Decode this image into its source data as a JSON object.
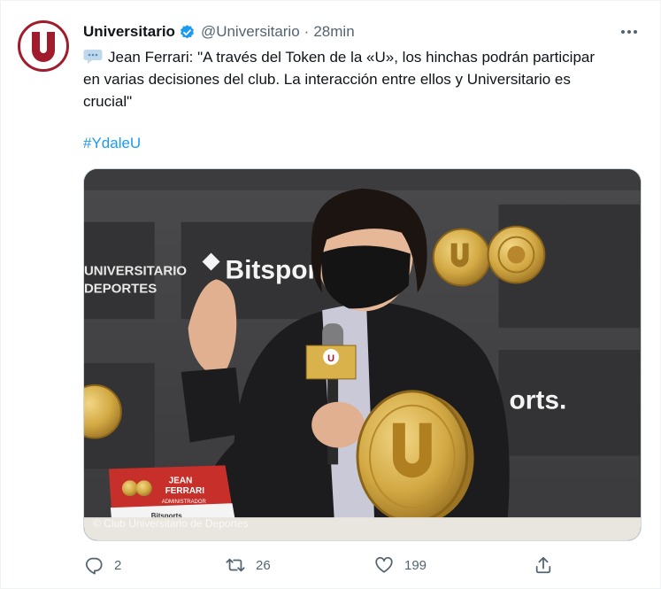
{
  "tweet": {
    "author_name": "Universitario",
    "author_handle": "@Universitario",
    "separator": "·",
    "time": "28min",
    "text": "Jean Ferrari: \"A través del Token de la «U», los hinchas podrán participar en varias decisiones del club. La interacción entre ellos y Universitario es crucial\"",
    "hashtag": "#YdaleU",
    "media": {
      "caption": "© Club Universitario de Deportes",
      "backdrop_text_1": "UNIVERSITARIO",
      "backdrop_text_2": "DEPORTES",
      "brand": "Bitsports",
      "brand_partial": "orts.",
      "nameplate_line1": "JEAN",
      "nameplate_line2": "FERRARI",
      "nameplate_line3": "ADMINISTRADOR",
      "nameplate_line4": "Bitsports",
      "mic_label": "U"
    },
    "stats": {
      "replies": "2",
      "retweets": "26",
      "likes": "199"
    }
  },
  "colors": {
    "brand_red": "#a01c2c",
    "link_blue": "#1d9bf0",
    "verified_blue": "#1d9bf0",
    "muted": "#536471",
    "coin_gold": "#d8b24a"
  },
  "icons": [
    "more-icon",
    "verified-icon",
    "speech-bubble-icon",
    "reply-icon",
    "retweet-icon",
    "like-icon",
    "share-icon"
  ]
}
